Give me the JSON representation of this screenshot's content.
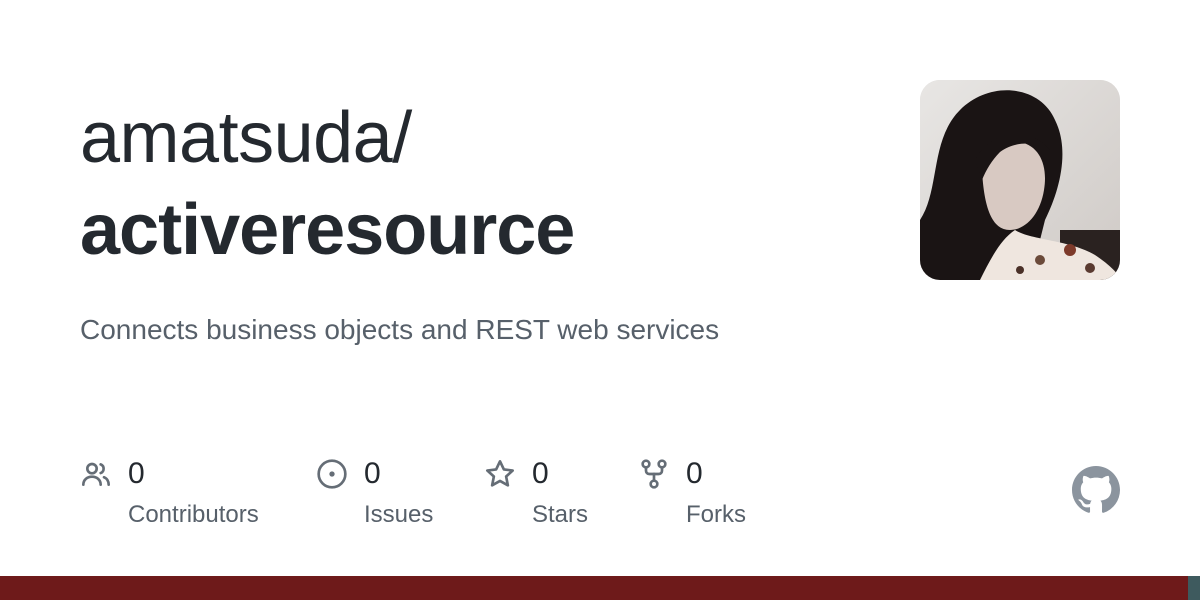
{
  "repo": {
    "owner": "amatsuda/",
    "name": "activeresource",
    "description": "Connects business objects and REST web services"
  },
  "stats": [
    {
      "icon": "people-icon",
      "count": "0",
      "label": "Contributors"
    },
    {
      "icon": "issue-opened-icon",
      "count": "0",
      "label": "Issues"
    },
    {
      "icon": "star-icon",
      "count": "0",
      "label": "Stars"
    },
    {
      "icon": "repo-forked-icon",
      "count": "0",
      "label": "Forks"
    }
  ],
  "colors": {
    "title": "#24292f",
    "muted": "#57606a",
    "icon": "#656d76",
    "github_logo": "#8b949e",
    "footer_bar": "#6e1a1a"
  }
}
